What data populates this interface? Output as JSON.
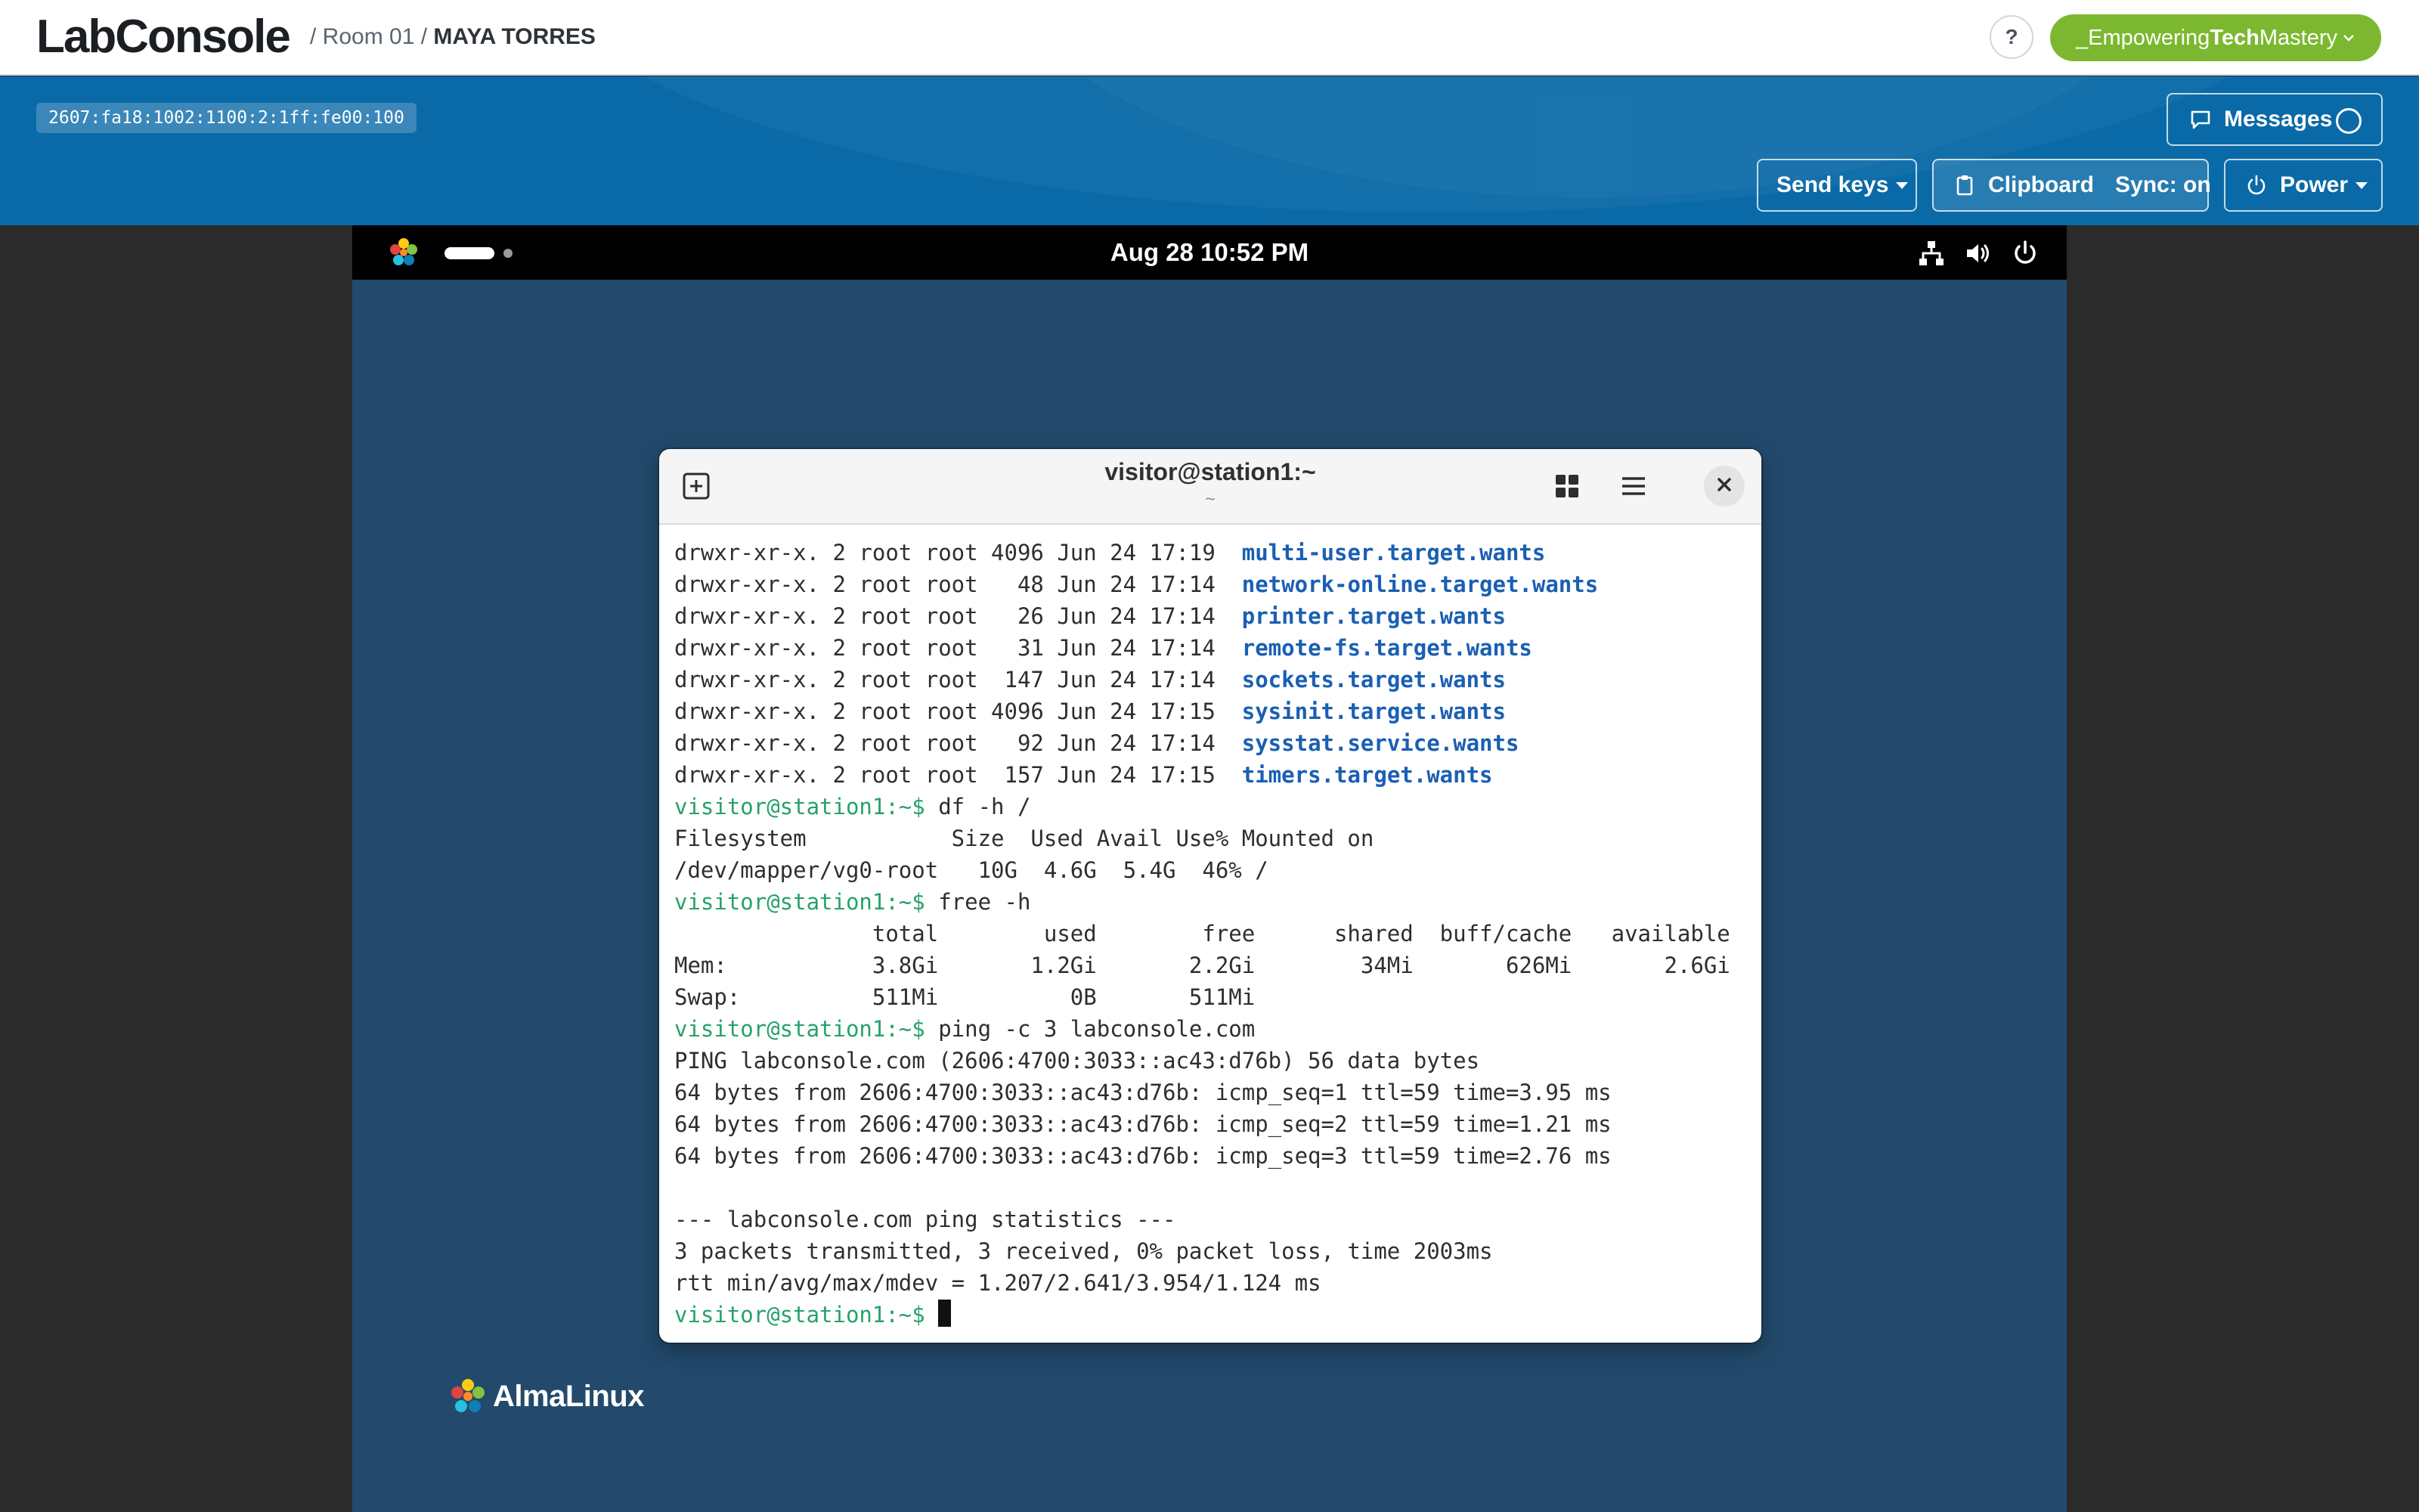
{
  "header": {
    "app_name": "LabConsole",
    "breadcrumb_sep1": "/ Room 01 /",
    "breadcrumb_user": "MAYA TORRES",
    "help_label": "?",
    "account_prefix": "_Empowering",
    "account_bold": "Tech",
    "account_suffix": "Mastery",
    "account_chevron_icon": "chevron-down-icon"
  },
  "toolbar": {
    "ip_address": "2607:fa18:1002:1100:2:1ff:fe00:100",
    "messages_label": "Messages",
    "send_keys_label": "Send keys",
    "clipboard_label": "Clipboard",
    "sync_label": "Sync: on",
    "power_label": "Power"
  },
  "vm": {
    "clock": "Aug 28  10:52 PM",
    "tray_icons": [
      "network-icon",
      "volume-icon",
      "power-icon"
    ],
    "distro_logo_text": "AlmaLinux"
  },
  "terminal": {
    "title": "visitor@station1:~",
    "subtitle": "~",
    "prompt": "visitor@station1:~$",
    "lines": [
      {
        "type": "ls",
        "text": "drwxr-xr-x. 2 root root 4096 Jun 24 17:19  ",
        "dir": "multi-user.target.wants"
      },
      {
        "type": "ls",
        "text": "drwxr-xr-x. 2 root root   48 Jun 24 17:14  ",
        "dir": "network-online.target.wants"
      },
      {
        "type": "ls",
        "text": "drwxr-xr-x. 2 root root   26 Jun 24 17:14  ",
        "dir": "printer.target.wants"
      },
      {
        "type": "ls",
        "text": "drwxr-xr-x. 2 root root   31 Jun 24 17:14  ",
        "dir": "remote-fs.target.wants"
      },
      {
        "type": "ls",
        "text": "drwxr-xr-x. 2 root root  147 Jun 24 17:14  ",
        "dir": "sockets.target.wants"
      },
      {
        "type": "ls",
        "text": "drwxr-xr-x. 2 root root 4096 Jun 24 17:15  ",
        "dir": "sysinit.target.wants"
      },
      {
        "type": "ls",
        "text": "drwxr-xr-x. 2 root root   92 Jun 24 17:14  ",
        "dir": "sysstat.service.wants"
      },
      {
        "type": "ls",
        "text": "drwxr-xr-x. 2 root root  157 Jun 24 17:15  ",
        "dir": "timers.target.wants"
      },
      {
        "type": "cmd",
        "text": " df -h /"
      },
      {
        "type": "out",
        "text": "Filesystem           Size  Used Avail Use% Mounted on"
      },
      {
        "type": "out",
        "text": "/dev/mapper/vg0-root   10G  4.6G  5.4G  46% /"
      },
      {
        "type": "cmd",
        "text": " free -h"
      },
      {
        "type": "out",
        "text": "               total        used        free      shared  buff/cache   available"
      },
      {
        "type": "out",
        "text": "Mem:           3.8Gi       1.2Gi       2.2Gi        34Mi       626Mi       2.6Gi"
      },
      {
        "type": "out",
        "text": "Swap:          511Mi          0B       511Mi"
      },
      {
        "type": "cmd",
        "text": " ping -c 3 labconsole.com"
      },
      {
        "type": "out",
        "text": "PING labconsole.com (2606:4700:3033::ac43:d76b) 56 data bytes"
      },
      {
        "type": "out",
        "text": "64 bytes from 2606:4700:3033::ac43:d76b: icmp_seq=1 ttl=59 time=3.95 ms"
      },
      {
        "type": "out",
        "text": "64 bytes from 2606:4700:3033::ac43:d76b: icmp_seq=2 ttl=59 time=1.21 ms"
      },
      {
        "type": "out",
        "text": "64 bytes from 2606:4700:3033::ac43:d76b: icmp_seq=3 ttl=59 time=2.76 ms"
      },
      {
        "type": "out",
        "text": ""
      },
      {
        "type": "out",
        "text": "--- labconsole.com ping statistics ---"
      },
      {
        "type": "out",
        "text": "3 packets transmitted, 3 received, 0% packet loss, time 2003ms"
      },
      {
        "type": "out",
        "text": "rtt min/avg/max/mdev = 1.207/2.641/3.954/1.124 ms"
      },
      {
        "type": "cursor",
        "text": " "
      }
    ]
  },
  "colors": {
    "header_bg": "#ffffff",
    "band_bg": "#0a6aa7",
    "account_green": "#7cb82f",
    "vm_desktop": "#234a6c",
    "prompt_green": "#26a269",
    "dir_blue": "#1a5fb4"
  }
}
